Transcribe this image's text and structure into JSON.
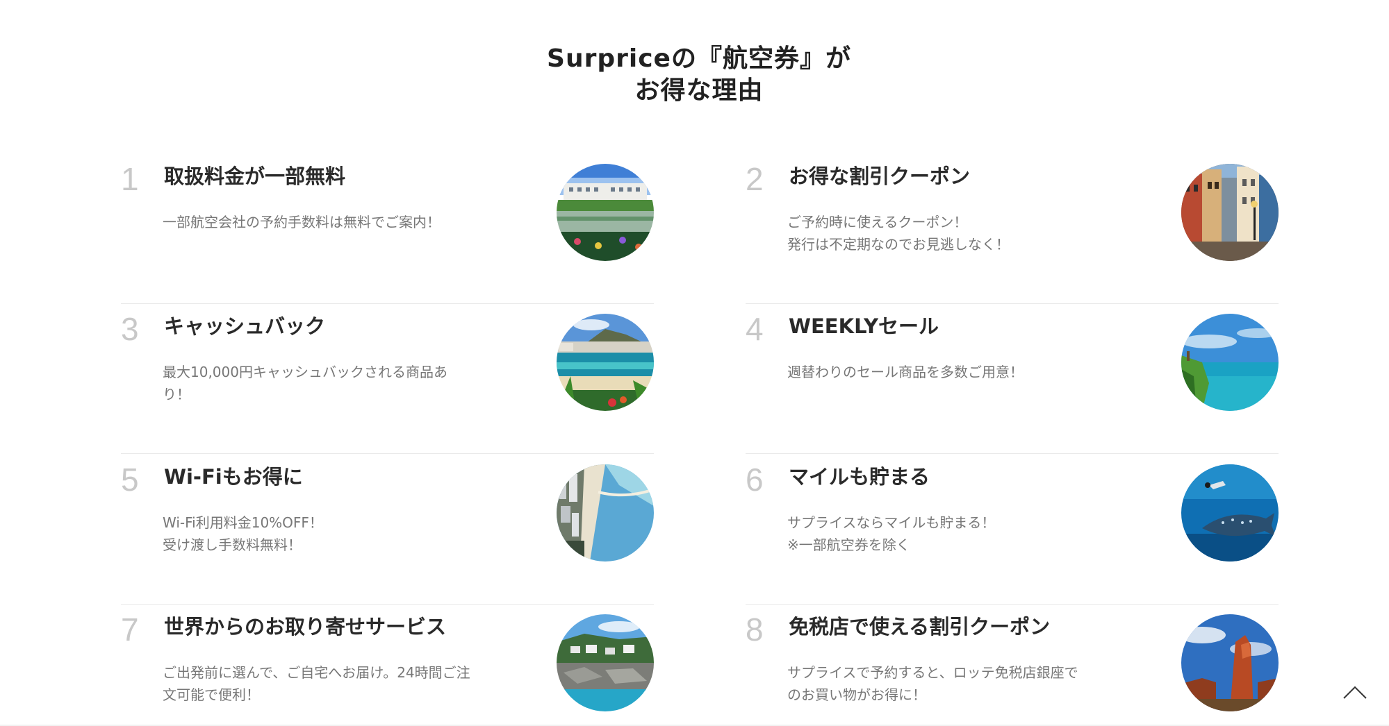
{
  "heading": {
    "line1": "Surpriceの『航空券』が",
    "line2": "お得な理由"
  },
  "reasons": [
    {
      "number": "1",
      "title": "取扱料金が一部無料",
      "lines": [
        "一部航空会社の予約手数料は無料でご案内！"
      ],
      "image": "palace-lake-photo"
    },
    {
      "number": "2",
      "title": "お得な割引クーポン",
      "lines": [
        "ご予約時に使えるクーポン！",
        "発行は不定期なのでお見逃しなく！"
      ],
      "image": "old-town-street-photo"
    },
    {
      "number": "3",
      "title": "キャッシュバック",
      "lines": [
        "最大10,000円キャッシュバックされる商品あ",
        "り！"
      ],
      "image": "tropical-beach-photo"
    },
    {
      "number": "4",
      "title": "WEEKLYセール",
      "lines": [
        "週替わりのセール商品を多数ご用意！"
      ],
      "image": "cliff-ocean-photo"
    },
    {
      "number": "5",
      "title": "Wi-Fiもお得に",
      "lines": [
        "Wi-Fi利用料金10%OFF！",
        "受け渡し手数料無料！"
      ],
      "image": "coastal-city-photo"
    },
    {
      "number": "6",
      "title": "マイルも貯まる",
      "lines": [
        "サプライスならマイルも貯まる！",
        "※一部航空券を除く"
      ],
      "image": "whale-shark-photo"
    },
    {
      "number": "7",
      "title": "世界からのお取り寄せサービス",
      "lines": [
        "ご出発前に選んで、ご自宅へお届け。24時間ご注",
        "文可能で便利！"
      ],
      "image": "rocky-coast-village-photo"
    },
    {
      "number": "8",
      "title": "免税店で使える割引クーポン",
      "lines": [
        "サプライスで予約すると、ロッテ免税店銀座で",
        "のお買い物がお得に！"
      ],
      "image": "red-rock-canyon-photo"
    }
  ],
  "back_to_top": {
    "icon": "chevron-up-icon"
  }
}
